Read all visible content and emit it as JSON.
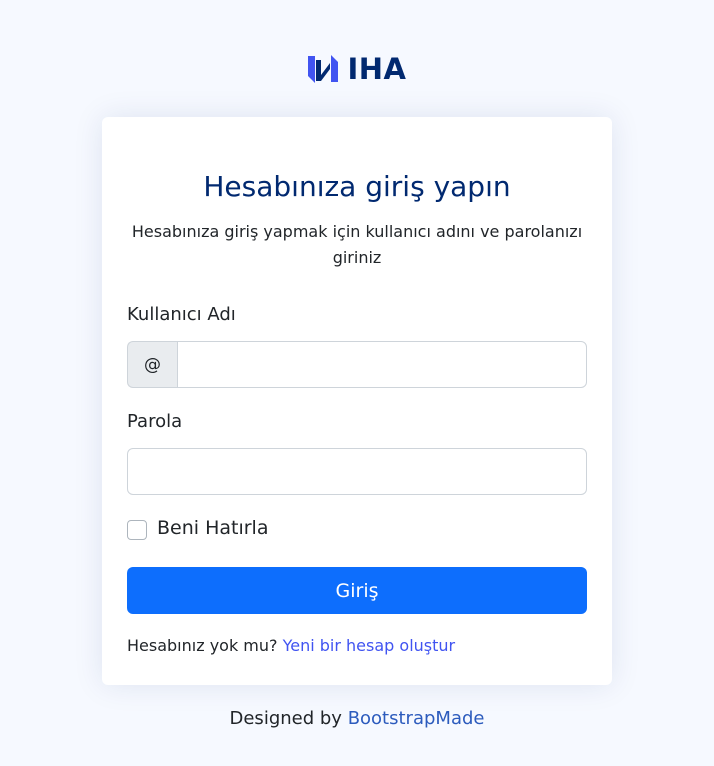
{
  "brand": {
    "name": "IHA",
    "accent": "#4154f1",
    "text_color": "#012970"
  },
  "card": {
    "title": "Hesabınıza giriş yapın",
    "subtitle": "Hesabınıza giriş yapmak için kullanıcı adını ve parolanızı giriniz"
  },
  "form": {
    "username_label": "Kullanıcı Adı",
    "username_prefix": "@",
    "username_value": "",
    "password_label": "Parola",
    "password_value": "",
    "remember_label": "Beni Hatırla",
    "remember_checked": false,
    "submit_label": "Giriş",
    "submit_color": "#0d6efd"
  },
  "register": {
    "prompt": "Hesabınız yok mu?",
    "link_label": "Yeni bir hesap oluştur"
  },
  "footer": {
    "prefix": "Designed by",
    "link_label": "BootstrapMade"
  },
  "icons": {
    "logo": "iha-logo-icon"
  }
}
